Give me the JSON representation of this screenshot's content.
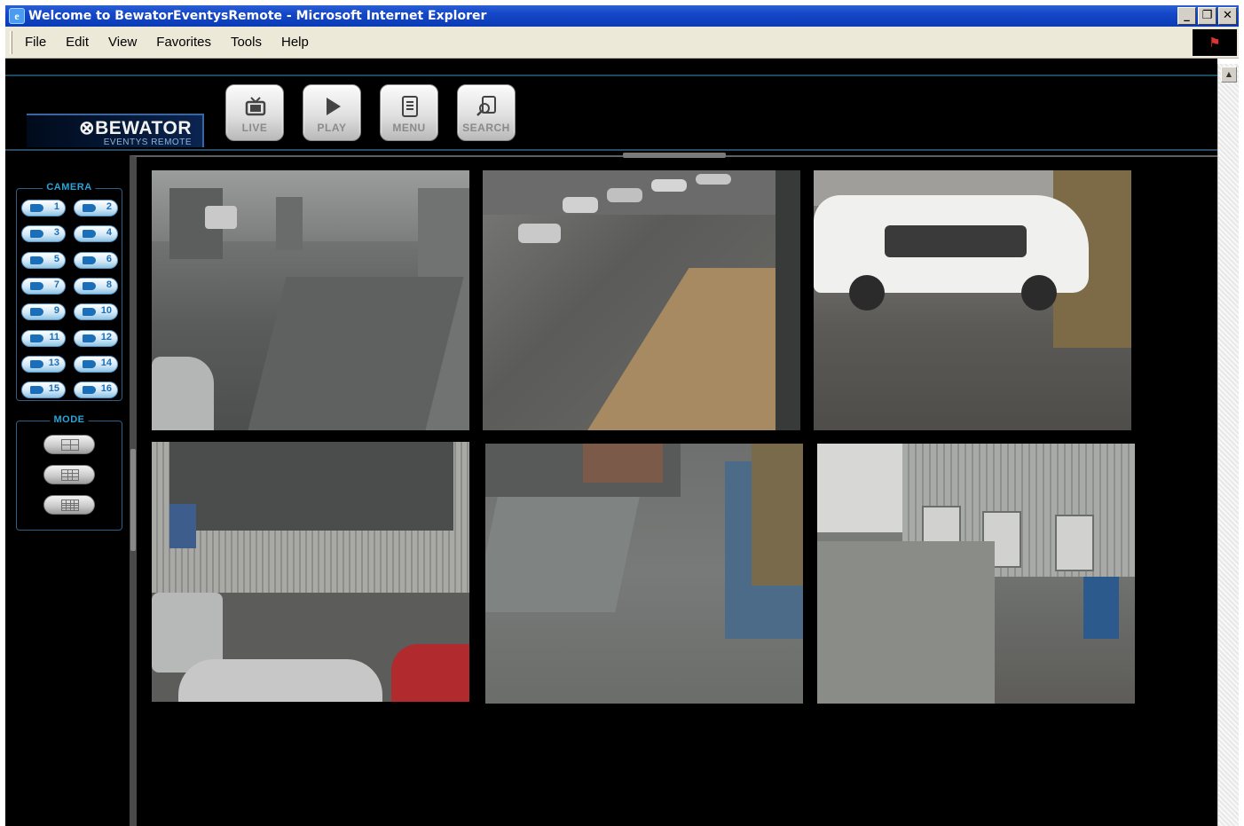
{
  "window": {
    "title": "Welcome to BewatorEventysRemote - Microsoft Internet Explorer",
    "icon": "ie-page-icon",
    "controls": {
      "minimize": "_",
      "restore": "❐",
      "close": "✕"
    }
  },
  "menubar": {
    "items": [
      "File",
      "Edit",
      "View",
      "Favorites",
      "Tools",
      "Help"
    ],
    "logo_icon": "windows-flag-icon"
  },
  "app": {
    "brand": {
      "name": "⊗BEWATOR",
      "subtitle": "EVENTYS REMOTE"
    },
    "nav": [
      {
        "label": "LIVE",
        "icon": "tv-icon"
      },
      {
        "label": "PLAY",
        "icon": "play-icon"
      },
      {
        "label": "MENU",
        "icon": "menu-list-icon"
      },
      {
        "label": "SEARCH",
        "icon": "search-doc-icon"
      }
    ],
    "camera_group": {
      "title": "CAMERA",
      "buttons": [
        "1",
        "2",
        "3",
        "4",
        "5",
        "6",
        "7",
        "8",
        "9",
        "10",
        "11",
        "12",
        "13",
        "14",
        "15",
        "16"
      ]
    },
    "mode_group": {
      "title": "MODE",
      "buttons": [
        {
          "name": "mode-2x2",
          "icon": "grid-4-icon"
        },
        {
          "name": "mode-3x3",
          "icon": "grid-9-icon"
        },
        {
          "name": "mode-4x4",
          "icon": "grid-16-icon"
        }
      ]
    },
    "video_tiles": [
      {
        "id": "cam-feed-1"
      },
      {
        "id": "cam-feed-2"
      },
      {
        "id": "cam-feed-3"
      },
      {
        "id": "cam-feed-4"
      },
      {
        "id": "cam-feed-5"
      },
      {
        "id": "cam-feed-6"
      }
    ]
  },
  "colors": {
    "titlebar": "#1447c8",
    "accent": "#2aa3d8",
    "background": "#000000"
  }
}
